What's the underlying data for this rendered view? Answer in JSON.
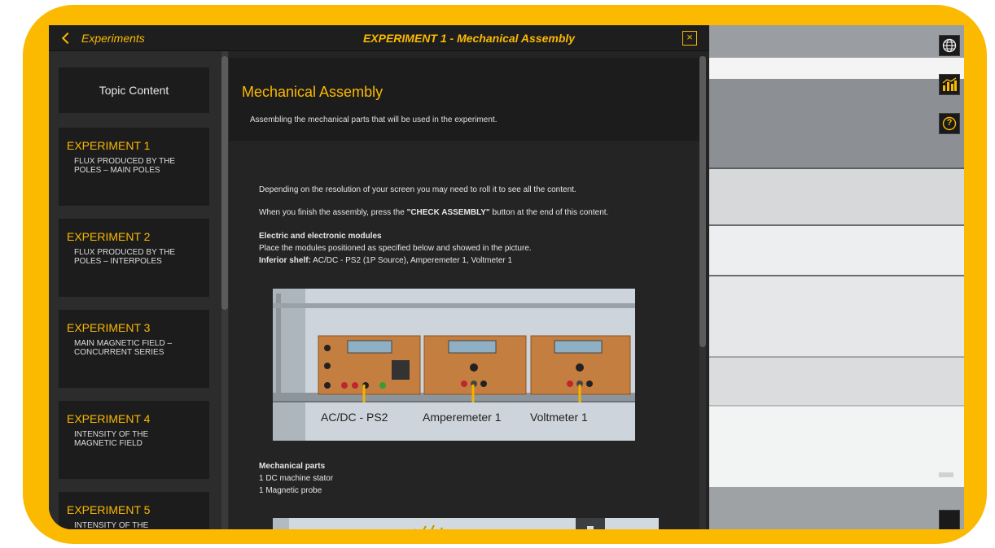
{
  "sidebar": {
    "back_label": "Experiments",
    "topic_content": "Topic Content",
    "experiments": [
      {
        "title": "EXPERIMENT 1",
        "desc": "FLUX PRODUCED BY THE POLES – MAIN POLES"
      },
      {
        "title": "EXPERIMENT 2",
        "desc": "FLUX PRODUCED BY THE POLES – INTERPOLES"
      },
      {
        "title": "EXPERIMENT 3",
        "desc": "MAIN MAGNETIC FIELD – CONCURRENT SERIES"
      },
      {
        "title": "EXPERIMENT 4",
        "desc": "INTENSITY OF THE MAGNETIC FIELD"
      },
      {
        "title": "EXPERIMENT 5",
        "desc": "INTENSITY OF THE"
      }
    ]
  },
  "content": {
    "header_title": "EXPERIMENT 1 - Mechanical Assembly",
    "close_label": "×",
    "heading": "Mechanical Assembly",
    "subheading": "Assembling the mechanical parts that will be used in the experiment.",
    "para1": "Depending on the resolution of your screen you may need to roll it to see all the content.",
    "para2_pre": "When you finish the assembly, press the ",
    "para2_bold": "\"CHECK ASSEMBLY\"",
    "para2_post": " button at the end of this content.",
    "modules_heading": "Electric and electronic modules",
    "modules_text": "Place the modules positioned as specified below and showed in the picture.",
    "shelf_label": "Inferior shelf:",
    "shelf_text": " AC/DC - PS2 (1P Source), Amperemeter 1, Voltmeter 1",
    "figure_labels": [
      "AC/DC - PS2",
      "Amperemeter 1",
      "Voltmeter 1"
    ],
    "mech_heading": "Mechanical parts",
    "mech_items": [
      "1 DC machine stator",
      "1 Magnetic probe"
    ]
  },
  "toolbar": {
    "icons": [
      "globe-icon",
      "chart-icon",
      "help-icon"
    ],
    "help_label": "?"
  },
  "colors": {
    "accent": "#fbb900",
    "panel": "#1c1c1c",
    "module_orange": "#c47e3f"
  }
}
